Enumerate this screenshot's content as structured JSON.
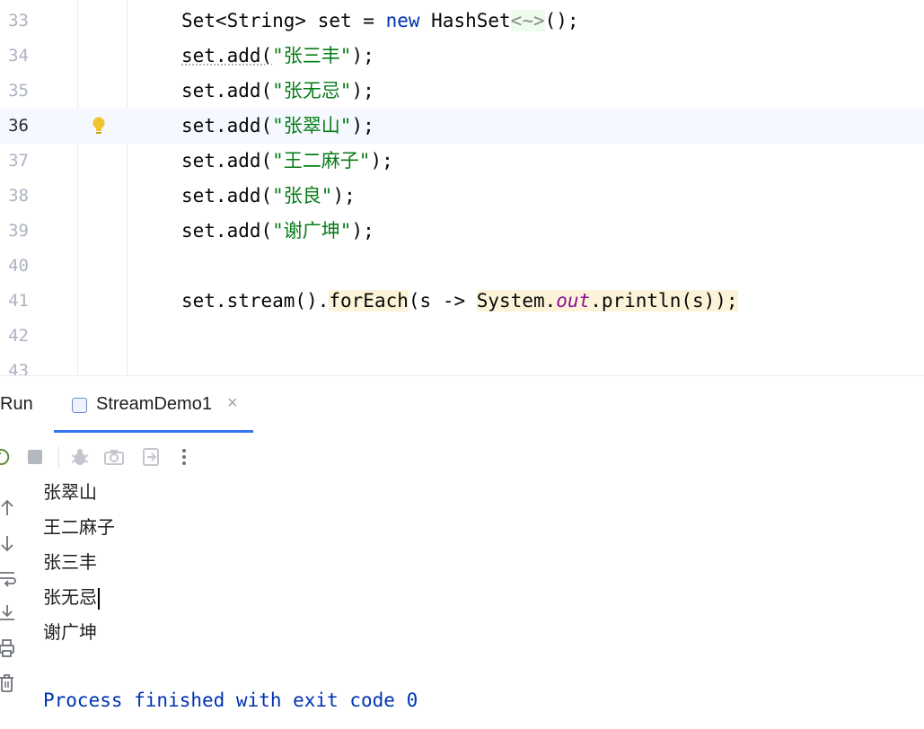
{
  "editor": {
    "lines": [
      {
        "num": "33"
      },
      {
        "num": "34"
      },
      {
        "num": "35"
      },
      {
        "num": "36"
      },
      {
        "num": "37"
      },
      {
        "num": "38"
      },
      {
        "num": "39"
      },
      {
        "num": "40"
      },
      {
        "num": "41"
      },
      {
        "num": "42"
      },
      {
        "num": "43"
      }
    ],
    "current_line": "36",
    "code": {
      "l33": {
        "a": "Set<String> set = ",
        "kw": "new",
        "b": " HashSet",
        "diamond": "<~>",
        "c": "();"
      },
      "l34": {
        "a": "set.add(",
        "s": "\"张三丰\"",
        "b": ");"
      },
      "l35": {
        "a": "set.add(",
        "s": "\"张无忌\"",
        "b": ");"
      },
      "l36": {
        "a": "set.add(",
        "s": "\"张翠山\"",
        "b": ");"
      },
      "l37": {
        "a": "set.add(",
        "s": "\"王二麻子\"",
        "b": ");"
      },
      "l38": {
        "a": "set.add(",
        "s": "\"张良\"",
        "b": ");"
      },
      "l39": {
        "a": "set.add(",
        "s": "\"谢广坤\"",
        "b": ");"
      },
      "l41": {
        "a": "set.stream().",
        "m": "forEach",
        "b": "(s -> ",
        "sys": "System.",
        "field": "out",
        "c": ".println(s));"
      }
    },
    "gutter_icon": "lightbulb-icon"
  },
  "run": {
    "title": "Run",
    "tab_label": "StreamDemo1",
    "tab_close": "×",
    "output": [
      "张翠山",
      "王二麻子",
      "张三丰",
      "张无忌",
      "谢广坤"
    ],
    "exit_message": "Process finished with exit code 0"
  },
  "icons": {
    "toolbar": [
      "rerun-icon",
      "stop-icon",
      "debug-icon",
      "screenshot-icon",
      "exit-icon",
      "more-icon"
    ],
    "side": [
      "arrow-up-icon",
      "arrow-down-icon",
      "soft-wrap-icon",
      "scroll-to-end-icon",
      "print-icon",
      "trash-icon"
    ]
  },
  "colors": {
    "keyword": "#0033b3",
    "string": "#067d17",
    "field": "#871094",
    "highlight": "#fcf3d9",
    "current_line": "#f5f8fe",
    "tab_underline": "#3574f0"
  }
}
